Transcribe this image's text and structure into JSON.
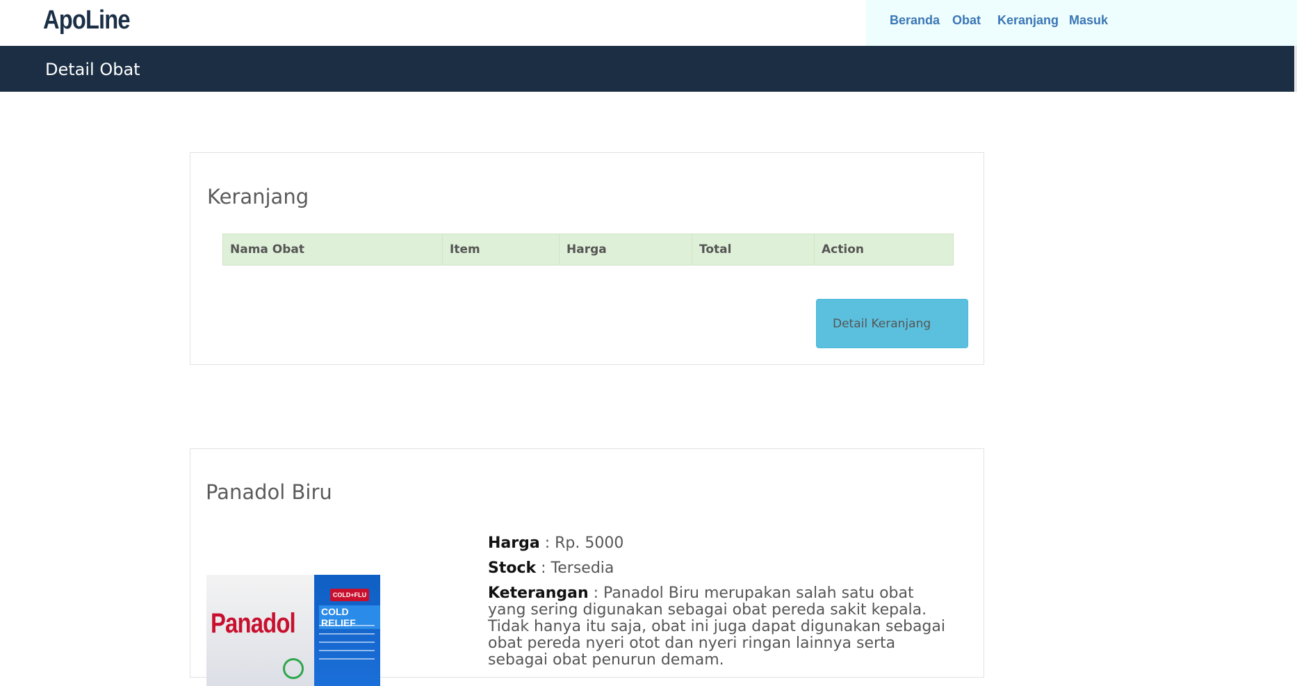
{
  "brand": "ApoLine",
  "nav": {
    "items": [
      "Beranda",
      "Obat",
      "Keranjang",
      "Masuk"
    ]
  },
  "header": {
    "title": "Detail Obat"
  },
  "cart": {
    "title": "Keranjang",
    "columns": [
      "Nama Obat",
      "Item",
      "Harga",
      "Total",
      "Action"
    ],
    "button_label": "Detail Keranjang"
  },
  "product": {
    "name": "Panadol Biru",
    "image_brand": "Panadol",
    "image_badge": "COLD+FLU",
    "image_caption": "COLD RELIEF",
    "price_label": "Harga",
    "price_value": " : Rp. 5000",
    "stock_label": "Stock",
    "stock_value": " : Tersedia",
    "desc_label": "Keterangan",
    "desc_value": " : Panadol Biru merupakan salah satu obat yang sering digunakan sebagai obat pereda sakit kepala. Tidak hanya itu saja, obat ini juga dapat digunakan sebagai obat pereda nyeri otot dan nyeri ringan lainnya serta sebagai obat penurun demam."
  },
  "colors": {
    "header_bg": "#1b2e43",
    "nav_link": "#3a76b6",
    "table_header_bg": "#dff0d8",
    "button_bg": "#5bc0de"
  }
}
